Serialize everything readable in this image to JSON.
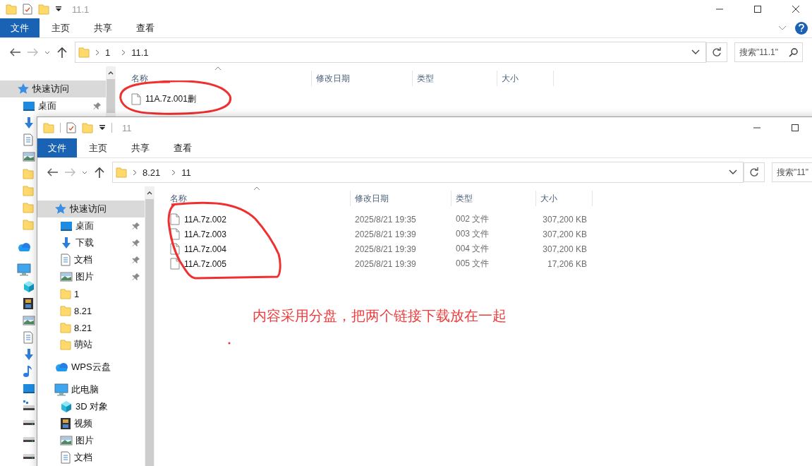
{
  "back_window": {
    "title": "11.1",
    "ribbon_tabs": [
      {
        "label": "文件",
        "selected": true
      },
      {
        "label": "主页",
        "selected": false
      },
      {
        "label": "共享",
        "selected": false
      },
      {
        "label": "查看",
        "selected": false
      }
    ],
    "breadcrumbs": [
      "1",
      "11.1"
    ],
    "search": {
      "placeholder": "搜索\"11.1\""
    },
    "sidebar": [
      {
        "label": "快速访问",
        "kind": "star",
        "selected": true,
        "children": [
          {
            "label": "桌面",
            "kind": "desktop",
            "pinned": true
          },
          {
            "kind": "download"
          },
          {
            "kind": "document"
          },
          {
            "kind": "picture"
          },
          {
            "kind": "folder"
          },
          {
            "kind": "folder"
          },
          {
            "kind": "folder"
          },
          {
            "kind": "folder"
          }
        ]
      },
      {
        "kind": "cloud",
        "selected": false
      },
      {
        "kind": "pc",
        "selected": false,
        "children": [
          {
            "kind": "cube"
          },
          {
            "kind": "film"
          },
          {
            "kind": "picture"
          },
          {
            "kind": "document"
          },
          {
            "kind": "download"
          },
          {
            "kind": "music"
          },
          {
            "kind": "desktop"
          },
          {
            "kind": "netdrive"
          },
          {
            "kind": "drive"
          },
          {
            "kind": "drive"
          },
          {
            "kind": "drive"
          }
        ]
      }
    ],
    "columns": [
      "名称",
      "修改日期",
      "类型",
      "大小"
    ],
    "files": [
      {
        "name": "11A.7z.001删"
      }
    ]
  },
  "front_window": {
    "title": "11",
    "ribbon_tabs": [
      {
        "label": "文件",
        "selected": true
      },
      {
        "label": "主页",
        "selected": false
      },
      {
        "label": "共享",
        "selected": false
      },
      {
        "label": "查看",
        "selected": false
      }
    ],
    "breadcrumbs": [
      "8.21",
      "11"
    ],
    "search": {
      "placeholder": "搜索\"11\""
    },
    "sidebar": [
      {
        "label": "快速访问",
        "kind": "star",
        "selected": true,
        "children": [
          {
            "label": "桌面",
            "kind": "desktop",
            "pinned": true
          },
          {
            "label": "下载",
            "kind": "download",
            "pinned": true
          },
          {
            "label": "文档",
            "kind": "document",
            "pinned": true
          },
          {
            "label": "图片",
            "kind": "picture",
            "pinned": true
          },
          {
            "label": "1",
            "kind": "folder",
            "pinned": false
          },
          {
            "label": "8.21",
            "kind": "folder",
            "pinned": false
          },
          {
            "label": "8.21",
            "kind": "folder",
            "pinned": false
          },
          {
            "label": "萌站",
            "kind": "folder",
            "pinned": false
          }
        ]
      },
      {
        "label": "WPS云盘",
        "kind": "cloud",
        "selected": false
      },
      {
        "label": "此电脑",
        "kind": "pc",
        "selected": false,
        "children": [
          {
            "label": "3D 对象",
            "kind": "cube"
          },
          {
            "label": "视频",
            "kind": "film"
          },
          {
            "label": "图片",
            "kind": "picture"
          },
          {
            "label": "文档",
            "kind": "document"
          }
        ]
      }
    ],
    "columns": [
      "名称",
      "修改日期",
      "类型",
      "大小"
    ],
    "files": [
      {
        "name": "11A.7z.002",
        "date": "2025/8/21 19:35",
        "type": "002 文件",
        "size": "307,200 KB"
      },
      {
        "name": "11A.7z.003",
        "date": "2025/8/21 19:39",
        "type": "003 文件",
        "size": "307,200 KB"
      },
      {
        "name": "11A.7z.004",
        "date": "2025/8/21 19:39",
        "type": "004 文件",
        "size": "307,200 KB"
      },
      {
        "name": "11A.7z.005",
        "date": "2025/8/21 19:39",
        "type": "005 文件",
        "size": "17,206 KB"
      }
    ],
    "note": "内容采用分盘，把两个链接下载放在一起"
  }
}
